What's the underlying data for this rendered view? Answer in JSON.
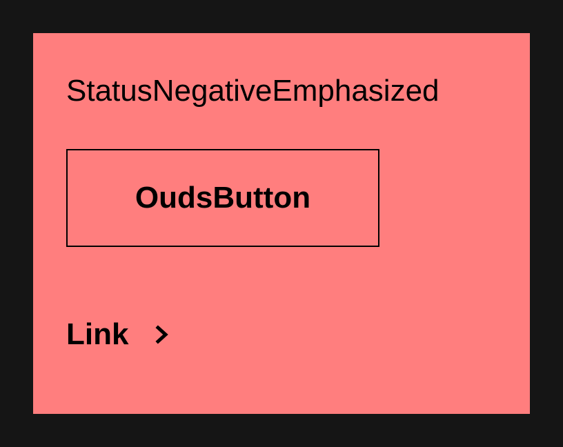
{
  "panel": {
    "title": "StatusNegativeEmphasized",
    "background": "#ff7e7e"
  },
  "button": {
    "label": "OudsButton"
  },
  "link": {
    "label": "Link",
    "icon": "chevron-right-icon"
  },
  "colors": {
    "page_background": "#151515",
    "foreground": "#000000"
  }
}
